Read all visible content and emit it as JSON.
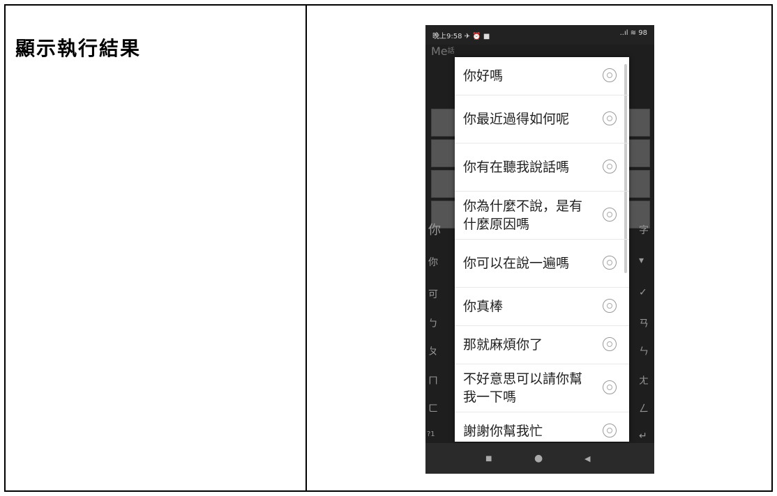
{
  "heading": "顯示執行結果",
  "status": {
    "time": "晚上9:58 ✈ ⏰ ■",
    "icons": "..ıl ≋ 98"
  },
  "app_title": "Me",
  "app_title_sub": "話",
  "background": {
    "left_chars": [
      "你",
      "你",
      "可",
      "ㄅ",
      "ㄆ",
      "ㄇ",
      "ㄈ",
      "?1"
    ],
    "right_chars": [
      "字",
      "▾",
      "✓",
      "ㄢ",
      "ㄣ",
      "ㄤ",
      "ㄥ",
      "↵"
    ]
  },
  "options": [
    {
      "label": "你好嗎"
    },
    {
      "label": "你最近過得如何呢"
    },
    {
      "label": "你有在聽我說話嗎"
    },
    {
      "label": "你為什麼不說，是有什麼原因嗎"
    },
    {
      "label": "你可以在說一遍嗎"
    },
    {
      "label": "你真棒"
    },
    {
      "label": "那就麻煩你了"
    },
    {
      "label": "不好意思可以請你幫我一下嗎"
    },
    {
      "label": "謝謝你幫我忙"
    }
  ],
  "nav": {
    "recent": "■",
    "home": "●",
    "back": "◀"
  }
}
